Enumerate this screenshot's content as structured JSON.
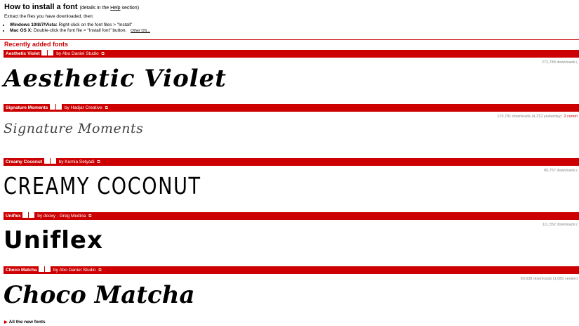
{
  "howto": {
    "title": "How to install a font",
    "details_prefix": "(details in the",
    "details_link": "Help",
    "details_suffix": "section)",
    "extract": "Extract the files you have downloaded, then:",
    "windows_label": "Windows 10/8/7/Vista:",
    "windows_text": "Right-click on the font files > \"Install\"",
    "mac_label": "Mac OS X:",
    "mac_text": "Double-click the font file > \"Install font\" button.",
    "other_os": "Other OS..."
  },
  "section_title": "Recently added fonts",
  "fonts": [
    {
      "name": "Aesthetic Violet",
      "by": "by Abo Daniel Studio",
      "downloads": "272,788 downloads (",
      "comments": "",
      "preview": "Aesthetic Violet"
    },
    {
      "name": "Signature Moments",
      "by": "by Hadjar Creative",
      "downloads": "123,791 downloads (4,312 yesterday)",
      "comments": "2 comm",
      "preview": "Signature Moments"
    },
    {
      "name": "Creamy Coconut",
      "by": "by Kurnia Setyadi",
      "downloads": "89,757 downloads (",
      "comments": "",
      "preview": "CREAMY COCONUT"
    },
    {
      "name": "Uniflex",
      "by": "by dcoxy - Greg Medina",
      "downloads": "111,352 downloads (",
      "comments": "",
      "preview": "Uniflex"
    },
    {
      "name": "Choco Matcha",
      "by": "by Abo Daniel Studio",
      "downloads": "80,638 downloads (1,080 yesterd",
      "comments": "",
      "preview": "Choco Matcha"
    }
  ],
  "all_new": "All the new fonts",
  "colors": {
    "accent": "#cc0000",
    "muted": "#888888"
  }
}
